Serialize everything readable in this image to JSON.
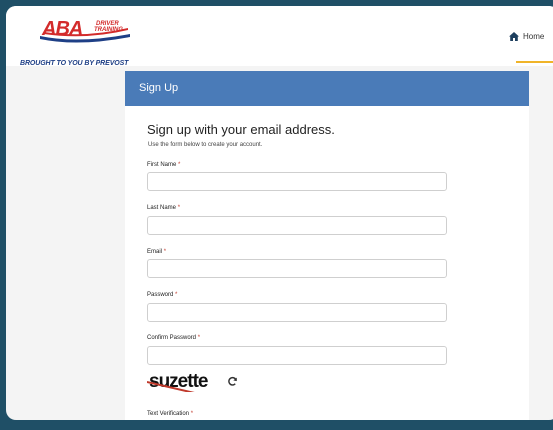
{
  "header": {
    "logo_text": "ABA",
    "logo_sub_1": "DRIVER",
    "logo_sub_2": "TRAINING",
    "tagline": "BROUGHT TO YOU BY PREVOST",
    "nav_home": "Home",
    "accent": "#f0b429"
  },
  "card": {
    "header_title": "Sign Up",
    "header_color": "#4a7bb8",
    "heading": "Sign up with your email address.",
    "subheading": "Use the form below to create your account.",
    "required_mark": "*"
  },
  "form": {
    "fields": [
      {
        "label": "First Name",
        "value": ""
      },
      {
        "label": "Last Name",
        "value": ""
      },
      {
        "label": "Email",
        "value": ""
      },
      {
        "label": "Password",
        "value": ""
      },
      {
        "label": "Confirm Password",
        "value": ""
      },
      {
        "label": "Text Verification",
        "value": ""
      }
    ],
    "captcha_text": "suzette"
  },
  "icons": {
    "home": "home-icon",
    "refresh": "refresh-icon"
  }
}
